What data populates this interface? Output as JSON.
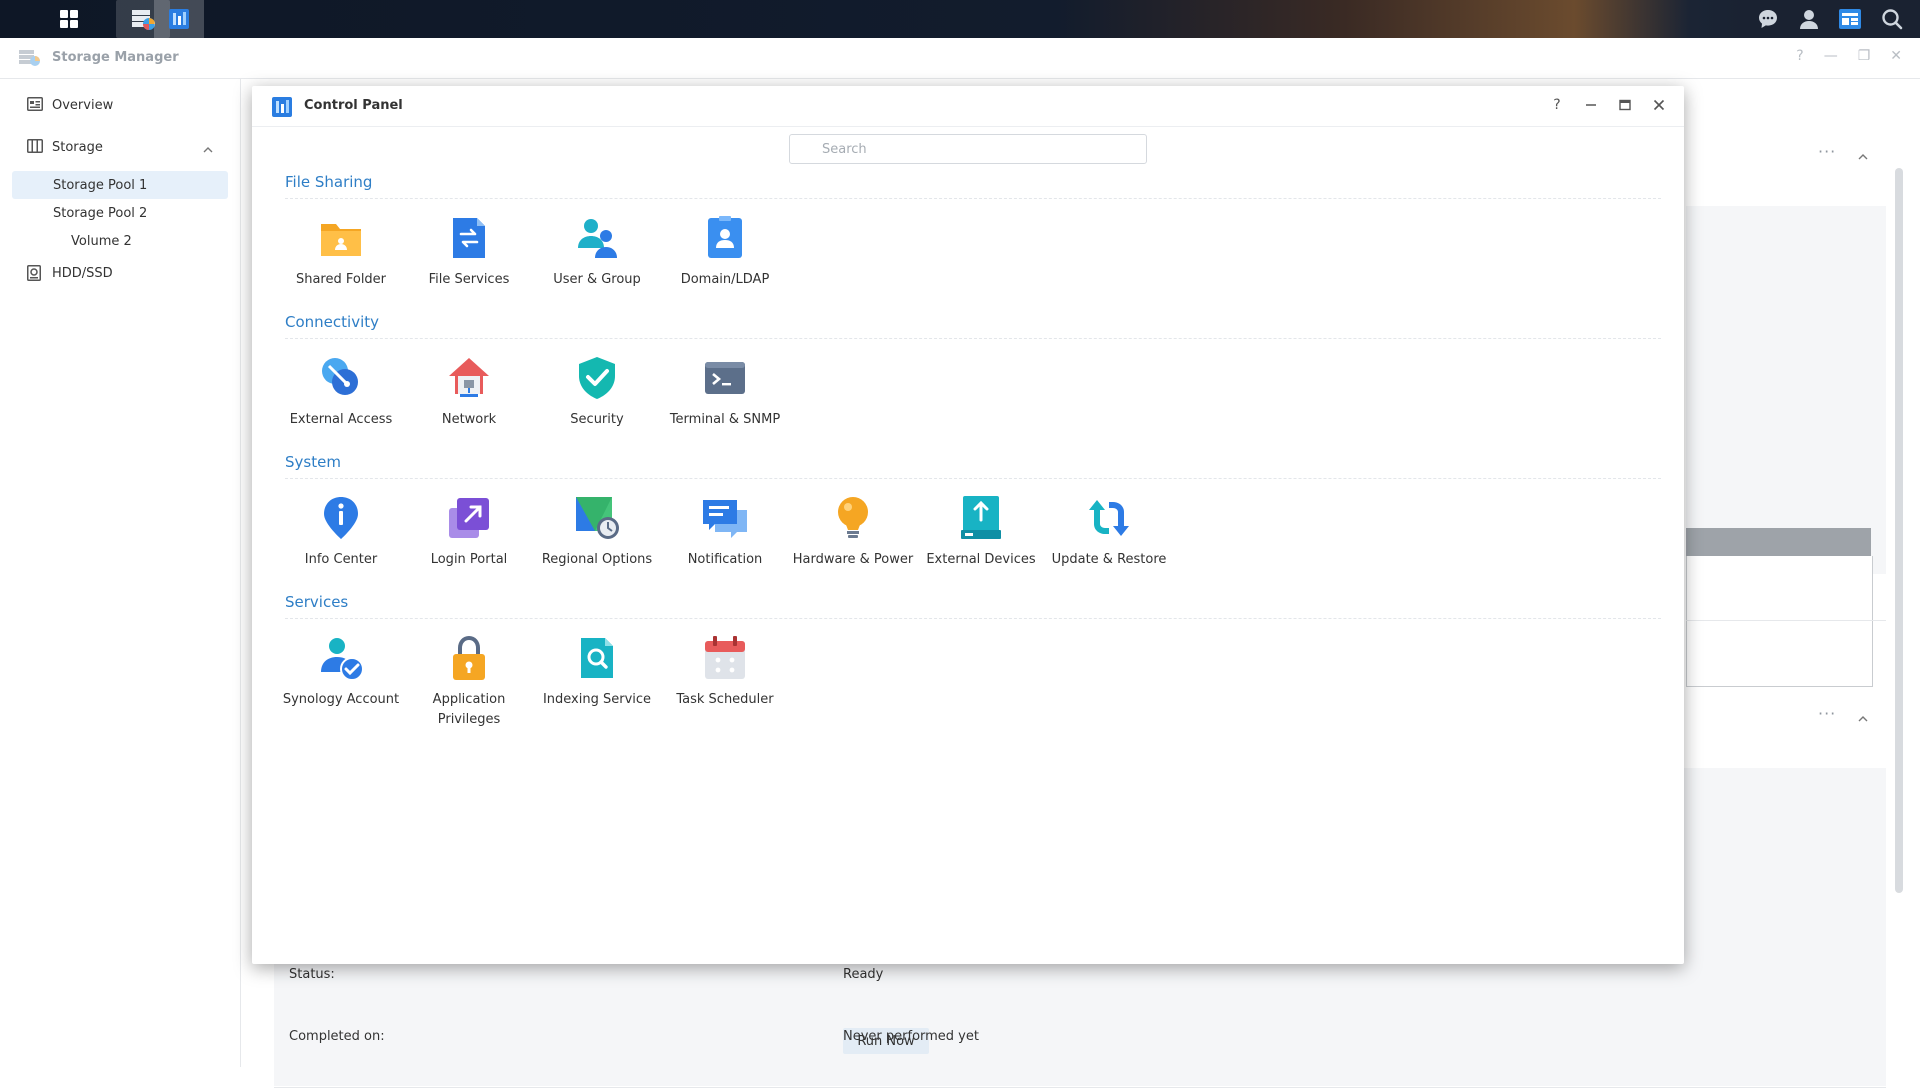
{
  "taskbar": {
    "right_icons": [
      "chat-icon",
      "user-icon",
      "widgets-icon",
      "search-icon"
    ]
  },
  "storage_manager": {
    "title": "Storage Manager",
    "sidebar": {
      "overview": "Overview",
      "storage": "Storage",
      "pool1": "Storage Pool 1",
      "pool2": "Storage Pool 2",
      "volume2": "Volume 2",
      "hdd": "HDD/SSD"
    },
    "task": {
      "status_label": "Status:",
      "status_value": "Ready",
      "run_button": "Run Now",
      "completed_label": "Completed on:",
      "completed_value": "Never performed yet"
    }
  },
  "control_panel": {
    "title": "Control Panel",
    "search_placeholder": "Search",
    "sections": {
      "file_sharing": {
        "title": "File Sharing",
        "items": [
          "Shared Folder",
          "File Services",
          "User & Group",
          "Domain/LDAP"
        ]
      },
      "connectivity": {
        "title": "Connectivity",
        "items": [
          "External Access",
          "Network",
          "Security",
          "Terminal & SNMP"
        ]
      },
      "system": {
        "title": "System",
        "items": [
          "Info Center",
          "Login Portal",
          "Regional Options",
          "Notification",
          "Hardware & Power",
          "External Devices",
          "Update & Restore"
        ]
      },
      "services": {
        "title": "Services",
        "items": [
          "Synology Account",
          "Application Privileges",
          "Indexing Service",
          "Task Scheduler"
        ]
      }
    }
  },
  "colors": {
    "accent": "#2e7ec6",
    "selected_bg": "#e6f0fa"
  }
}
